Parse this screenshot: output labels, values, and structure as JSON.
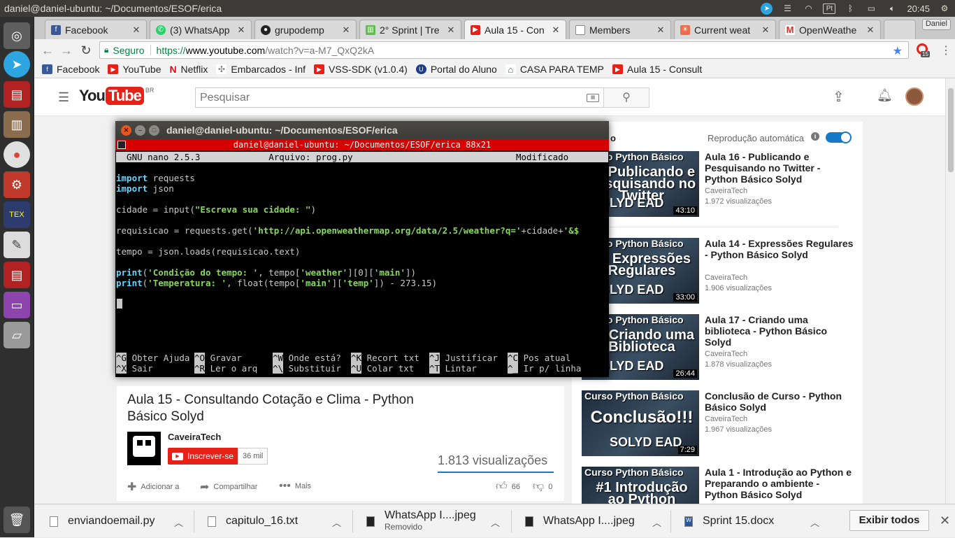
{
  "top_panel": {
    "window_title": "daniel@daniel-ubuntu: ~/Documentos/ESOF/erica",
    "clock": "20:45",
    "pt_label": "Pt"
  },
  "launcher": {
    "items": [
      "dash-icon",
      "telegram-icon",
      "presentation-icon",
      "files-icon",
      "chrome-icon",
      "settings-icon",
      "tex-icon",
      "editor-icon",
      "presentation2-icon",
      "window-icon",
      "drive-icon",
      "trash-icon"
    ]
  },
  "tabs": [
    {
      "label": "Facebook",
      "icon": "facebook-icon",
      "color": "#3b5998",
      "active": false
    },
    {
      "label": "(3) WhatsApp",
      "icon": "whatsapp-icon",
      "color": "#25d366",
      "active": false
    },
    {
      "label": "grupodemp",
      "icon": "github-icon",
      "color": "#222222",
      "active": false
    },
    {
      "label": "2° Sprint | Tre",
      "icon": "trello-icon",
      "color": "#61bd4f",
      "active": false
    },
    {
      "label": "Aula 15 - Con",
      "icon": "youtube-icon",
      "color": "#e62117",
      "active": true
    },
    {
      "label": "Members",
      "icon": "page-icon",
      "color": "#888888",
      "active": false
    },
    {
      "label": "Current weat",
      "icon": "openweather-icon",
      "color": "#eb6e4b",
      "active": false
    },
    {
      "label": "OpenWeathe",
      "icon": "gmail-icon",
      "color": "#d93025",
      "active": false
    }
  ],
  "profile_label": "Daniel",
  "omnibox": {
    "secure_label": "Seguro",
    "scheme": "https://",
    "host": "www.youtube.com",
    "path": "/watch?v=a-M7_QxQ2kA"
  },
  "extension_badge": "15",
  "bookmarks": [
    {
      "label": "Facebook",
      "icon": "facebook-icon",
      "color": "#3b5998"
    },
    {
      "label": "YouTube",
      "icon": "youtube-icon",
      "color": "#e62117"
    },
    {
      "label": "Netflix",
      "icon": "netflix-icon",
      "color": "#e50914"
    },
    {
      "label": "Embarcados - Inf",
      "icon": "embarcados-icon",
      "color": "#777777"
    },
    {
      "label": "VSS-SDK (v1.0.4)",
      "icon": "youtube-icon",
      "color": "#e62117"
    },
    {
      "label": "Portal do Aluno",
      "icon": "portal-icon",
      "color": "#1a3e8c"
    },
    {
      "label": "CASA PARA TEMP",
      "icon": "house-icon",
      "color": "#2c5aa0"
    },
    {
      "label": "Aula 15 - Consult",
      "icon": "youtube-icon",
      "color": "#e62117"
    }
  ],
  "youtube": {
    "logo_you": "You",
    "logo_tube": "Tube",
    "region": "BR",
    "search_placeholder": "Pesquisar",
    "video_title": "Aula 15 - Consultando Cotação e Clima - Python Básico Solyd",
    "channel_name": "CaveiraTech",
    "subscribe_label": "Inscrever-se",
    "subscriber_count": "36 mil",
    "views": "1.813 visualizações",
    "add_label": "Adicionar a",
    "share_label": "Compartilhar",
    "more_label": "Mais",
    "likes": "66",
    "dislikes": "0",
    "autoplay_label": "Reprodução automática",
    "autoplay_fragment": "o",
    "recommendations": [
      {
        "title": "Aula 16 - Publicando e Pesquisando no Twitter - Python Básico Solyd",
        "channel": "CaveiraTech",
        "views": "1.972 visualizações",
        "duration": "43:10",
        "thumb_top": "Curso Python Básico",
        "thumb_main": "16 Publicando e Pesquisando no Twitter",
        "thumb_brand": "SOLYD EAD"
      },
      {
        "title": "Aula 14 - Expressões Regulares - Python Básico Solyd",
        "channel": "CaveiraTech",
        "views": "1.906 visualizações",
        "duration": "33:00",
        "thumb_top": "Curso Python Básico",
        "thumb_main": "14 Expressões Regulares",
        "thumb_brand": "SOLYD EAD"
      },
      {
        "title": "Aula 17 - Criando uma biblioteca - Python Básico Solyd",
        "channel": "CaveiraTech",
        "views": "1.878 visualizações",
        "duration": "26:44",
        "thumb_top": "Curso Python Básico",
        "thumb_main": "17 Criando uma Biblioteca",
        "thumb_brand": "SOLYD EAD"
      },
      {
        "title": "Conclusão de Curso - Python Básico Solyd",
        "channel": "CaveiraTech",
        "views": "1.967 visualizações",
        "duration": "7:29",
        "thumb_top": "Curso Python Básico",
        "thumb_main": "Conclusão!!!",
        "thumb_brand": "SOLYD EAD"
      },
      {
        "title": "Aula 1 - Introdução ao Python e Preparando o ambiente - Python Básico Solyd",
        "channel": "",
        "views": "",
        "duration": "",
        "thumb_top": "Curso Python Básico",
        "thumb_main": "#1 Introdução ao Python",
        "thumb_brand": ""
      }
    ]
  },
  "terminal": {
    "title": "daniel@daniel-ubuntu: ~/Documentos/ESOF/erica",
    "subtitle": "daniel@daniel-ubuntu: ~/Documentos/ESOF/erica 88x21",
    "nano_header": "  GNU nano 2.5.3             Arquivo: prog.py                               Modificado  ",
    "code_lines": [
      [
        {
          "t": "import",
          "c": "kw"
        },
        {
          "t": " requests",
          "c": ""
        }
      ],
      [
        {
          "t": "import",
          "c": "kw"
        },
        {
          "t": " json",
          "c": ""
        }
      ],
      [],
      [
        {
          "t": "cidade = input(",
          "c": ""
        },
        {
          "t": "\"Escreva sua cidade: \"",
          "c": "str"
        },
        {
          "t": ")",
          "c": ""
        }
      ],
      [],
      [
        {
          "t": "requisicao = requests.get(",
          "c": ""
        },
        {
          "t": "'http://api.openweathermap.org/data/2.5/weather?q='",
          "c": "str"
        },
        {
          "t": "+cidade+",
          "c": ""
        },
        {
          "t": "'&$",
          "c": "str"
        }
      ],
      [],
      [
        {
          "t": "tempo = json.loads(requisicao.text)",
          "c": ""
        }
      ],
      [],
      [
        {
          "t": "print",
          "c": "kw"
        },
        {
          "t": "(",
          "c": ""
        },
        {
          "t": "'Condição do tempo: '",
          "c": "str"
        },
        {
          "t": ", tempo[",
          "c": ""
        },
        {
          "t": "'weather'",
          "c": "str"
        },
        {
          "t": "][0][",
          "c": ""
        },
        {
          "t": "'main'",
          "c": "str"
        },
        {
          "t": "])",
          "c": ""
        }
      ],
      [
        {
          "t": "print",
          "c": "kw"
        },
        {
          "t": "(",
          "c": ""
        },
        {
          "t": "'Temperatura: '",
          "c": "str"
        },
        {
          "t": ", float(tempo[",
          "c": ""
        },
        {
          "t": "'main'",
          "c": "str"
        },
        {
          "t": "][",
          "c": ""
        },
        {
          "t": "'temp'",
          "c": "str"
        },
        {
          "t": "]) - 273.15)",
          "c": ""
        }
      ]
    ],
    "shortcuts": [
      {
        "key": "^G",
        "label": "Obter Ajuda"
      },
      {
        "key": "^O",
        "label": "Gravar"
      },
      {
        "key": "^W",
        "label": "Onde está?"
      },
      {
        "key": "^K",
        "label": "Recort txt"
      },
      {
        "key": "^J",
        "label": "Justificar"
      },
      {
        "key": "^C",
        "label": "Pos atual"
      },
      {
        "key": "^X",
        "label": "Sair"
      },
      {
        "key": "^R",
        "label": "Ler o arq"
      },
      {
        "key": "^\\",
        "label": "Substituir"
      },
      {
        "key": "^U",
        "label": "Colar txt"
      },
      {
        "key": "^T",
        "label": "Lintar"
      },
      {
        "key": "^_",
        "label": "Ir p/ linha"
      }
    ]
  },
  "downloads": {
    "items": [
      {
        "name": "enviandoemail.py",
        "status": ""
      },
      {
        "name": "capitulo_16.txt",
        "status": ""
      },
      {
        "name": "WhatsApp I....jpeg",
        "status": "Removido"
      },
      {
        "name": "WhatsApp I....jpeg",
        "status": ""
      },
      {
        "name": "Sprint 15.docx",
        "status": ""
      }
    ],
    "show_all_label": "Exibir todos"
  }
}
